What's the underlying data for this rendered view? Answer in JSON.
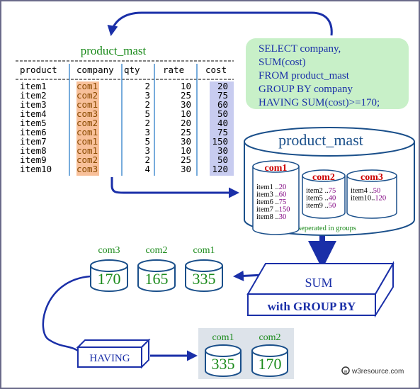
{
  "table": {
    "title": "product_mast",
    "headers": [
      "product",
      "company",
      "qty",
      "rate",
      "cost"
    ],
    "rows": [
      [
        "item1",
        "com1",
        "2",
        "10",
        "20"
      ],
      [
        "item2",
        "com2",
        "3",
        "25",
        "75"
      ],
      [
        "item3",
        "com1",
        "2",
        "30",
        "60"
      ],
      [
        "item4",
        "com3",
        "5",
        "10",
        "50"
      ],
      [
        "item5",
        "com2",
        "2",
        "20",
        "40"
      ],
      [
        "item6",
        "com1",
        "3",
        "25",
        "75"
      ],
      [
        "item7",
        "com1",
        "5",
        "30",
        "150"
      ],
      [
        "item8",
        "com1",
        "3",
        "10",
        "30"
      ],
      [
        "item9",
        "com2",
        "2",
        "25",
        "50"
      ],
      [
        "item10",
        "com3",
        "4",
        "30",
        "120"
      ]
    ]
  },
  "sql": [
    "SELECT company,",
    "SUM(cost)",
    "FROM product_mast",
    "GROUP BY company",
    "HAVING SUM(cost)>=170;"
  ],
  "database": {
    "title": "product_mast",
    "caption": "seperated in groups",
    "groups": [
      {
        "name": "com1",
        "items": [
          [
            "item1 ..",
            "20"
          ],
          [
            "item3 ..",
            "60"
          ],
          [
            "item6 ..",
            "75"
          ],
          [
            "item7 ..",
            "150"
          ],
          [
            "item8 ..",
            "30"
          ]
        ]
      },
      {
        "name": "com2",
        "items": [
          [
            "item2 ..",
            "75"
          ],
          [
            "item5 ..",
            "40"
          ],
          [
            "item9 ..",
            "50"
          ]
        ]
      },
      {
        "name": "com3",
        "items": [
          [
            "item4 ..",
            "50"
          ],
          [
            "item10..",
            "120"
          ]
        ]
      }
    ]
  },
  "sum_box": {
    "line1": "SUM",
    "line2": "with GROUP BY"
  },
  "sums": [
    {
      "name": "com3",
      "value": "170"
    },
    {
      "name": "com2",
      "value": "165"
    },
    {
      "name": "com1",
      "value": "335"
    }
  ],
  "having_label": "HAVING",
  "result": [
    {
      "name": "com1",
      "value": "335"
    },
    {
      "name": "com2",
      "value": "170"
    }
  ],
  "logo": "w3resource.com",
  "colors": {
    "arrow": "#1a2fa8",
    "green": "#1a8a1a",
    "red": "#cc0000",
    "purple": "#800080",
    "orange": "#f8c09a",
    "lavender": "#c8ccf0",
    "sqlbox": "#c8f0c8"
  }
}
